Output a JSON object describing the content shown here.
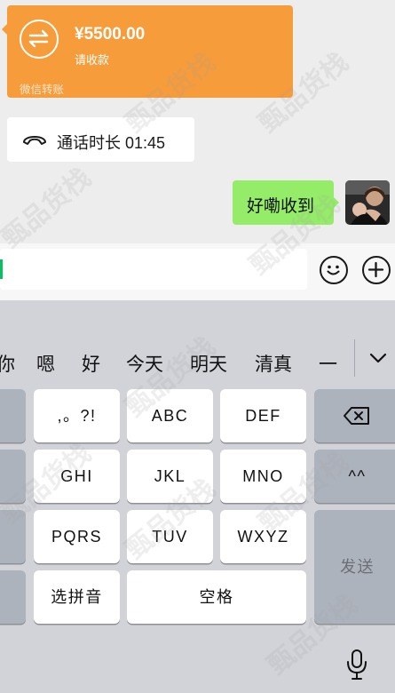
{
  "transfer": {
    "amount": "¥5500.00",
    "subtitle": "请收款",
    "footer": "微信转账"
  },
  "call": {
    "text": "通话时长 01:45"
  },
  "sent_message": {
    "text": "好嘞收到"
  },
  "keyboard": {
    "candidates": [
      "你",
      "嗯",
      "好",
      "今天",
      "明天",
      "清真",
      "一"
    ],
    "keys": {
      "punct": ",。?!",
      "abc": "ABC",
      "def": "DEF",
      "ghi": "GHI",
      "jkl": "JKL",
      "mno": "MNO",
      "pqrs": "PQRS",
      "tuv": "TUV",
      "wxyz": "WXYZ",
      "pinyin": "选拼音",
      "space": "空格",
      "emoticon": "^^",
      "send": "发送"
    }
  },
  "watermark": "甄品货栈",
  "colors": {
    "transfer": "#f79c3a",
    "sent_bubble": "#95ec69",
    "cursor": "#07c160"
  }
}
